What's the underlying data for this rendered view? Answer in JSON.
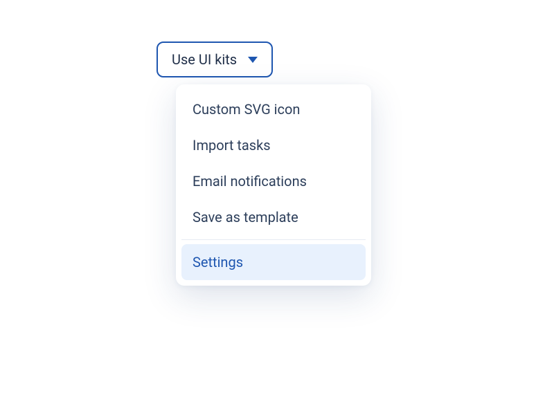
{
  "dropdown": {
    "trigger_label": "Use UI kits",
    "items": [
      {
        "label": "Custom SVG icon"
      },
      {
        "label": "Import tasks"
      },
      {
        "label": "Email notifications"
      },
      {
        "label": "Save as template"
      }
    ],
    "footer_item": {
      "label": "Settings"
    }
  },
  "colors": {
    "accent": "#1e56b0",
    "highlight_bg": "#e8f1fd",
    "text": "#2c3e5a"
  }
}
